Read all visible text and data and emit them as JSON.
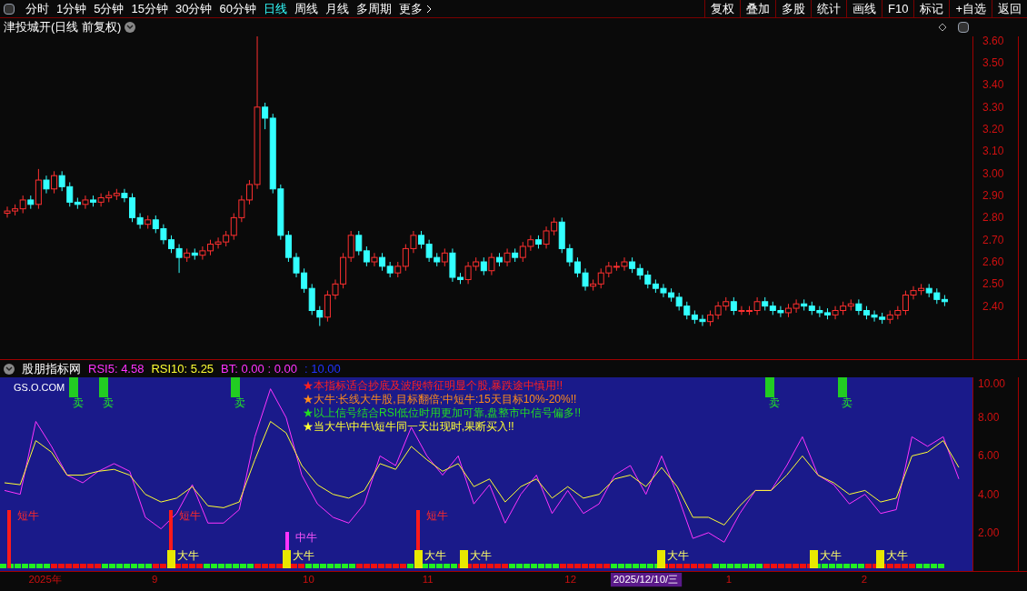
{
  "toolbar": {
    "periods": [
      {
        "label": "分时",
        "selected": false
      },
      {
        "label": "1分钟",
        "selected": false
      },
      {
        "label": "5分钟",
        "selected": false
      },
      {
        "label": "15分钟",
        "selected": false
      },
      {
        "label": "30分钟",
        "selected": false
      },
      {
        "label": "60分钟",
        "selected": false
      },
      {
        "label": "日线",
        "selected": true
      },
      {
        "label": "周线",
        "selected": false
      },
      {
        "label": "月线",
        "selected": false
      },
      {
        "label": "多周期",
        "selected": false
      }
    ],
    "more": "更多",
    "buttons": [
      "复权",
      "叠加",
      "多股",
      "统计",
      "画线",
      "F10",
      "标记",
      "+自选",
      "返回"
    ]
  },
  "main_chart": {
    "title": "津投城开(日线 前复权)",
    "chart_data": {
      "type": "candlestick",
      "ylim": [
        2.16,
        3.62
      ],
      "yticks": [
        {
          "value": 3.6,
          "label": "3.60"
        },
        {
          "value": 3.5,
          "label": "3.50"
        },
        {
          "value": 3.4,
          "label": "3.40"
        },
        {
          "value": 3.3,
          "label": "3.30"
        },
        {
          "value": 3.2,
          "label": "3.20"
        },
        {
          "value": 3.1,
          "label": "3.10"
        },
        {
          "value": 3.0,
          "label": "3.00"
        },
        {
          "value": 2.9,
          "label": "2.90"
        },
        {
          "value": 2.8,
          "label": "2.80"
        },
        {
          "value": 2.7,
          "label": "2.70"
        },
        {
          "value": 2.6,
          "label": "2.60"
        },
        {
          "value": 2.5,
          "label": "2.50"
        },
        {
          "value": 2.4,
          "label": "2.40"
        }
      ],
      "ohlc": [
        [
          2.82,
          2.85,
          2.8,
          2.83
        ],
        [
          2.83,
          2.86,
          2.81,
          2.84
        ],
        [
          2.84,
          2.9,
          2.82,
          2.88
        ],
        [
          2.88,
          2.9,
          2.84,
          2.86
        ],
        [
          2.86,
          3.02,
          2.84,
          2.97
        ],
        [
          2.97,
          2.99,
          2.91,
          2.93
        ],
        [
          2.93,
          3.01,
          2.91,
          2.99
        ],
        [
          2.99,
          3.01,
          2.92,
          2.94
        ],
        [
          2.94,
          2.96,
          2.85,
          2.87
        ],
        [
          2.87,
          2.89,
          2.84,
          2.86
        ],
        [
          2.86,
          2.9,
          2.84,
          2.88
        ],
        [
          2.88,
          2.9,
          2.85,
          2.87
        ],
        [
          2.87,
          2.91,
          2.85,
          2.89
        ],
        [
          2.89,
          2.92,
          2.87,
          2.9
        ],
        [
          2.9,
          2.93,
          2.88,
          2.91
        ],
        [
          2.91,
          2.93,
          2.87,
          2.89
        ],
        [
          2.89,
          2.91,
          2.78,
          2.8
        ],
        [
          2.8,
          2.82,
          2.75,
          2.77
        ],
        [
          2.77,
          2.81,
          2.75,
          2.79
        ],
        [
          2.79,
          2.81,
          2.73,
          2.75
        ],
        [
          2.75,
          2.77,
          2.68,
          2.7
        ],
        [
          2.7,
          2.72,
          2.64,
          2.66
        ],
        [
          2.66,
          2.68,
          2.55,
          2.62
        ],
        [
          2.62,
          2.66,
          2.6,
          2.64
        ],
        [
          2.64,
          2.66,
          2.61,
          2.63
        ],
        [
          2.63,
          2.67,
          2.61,
          2.65
        ],
        [
          2.65,
          2.7,
          2.63,
          2.68
        ],
        [
          2.68,
          2.71,
          2.66,
          2.69
        ],
        [
          2.69,
          2.74,
          2.67,
          2.72
        ],
        [
          2.72,
          2.82,
          2.7,
          2.8
        ],
        [
          2.8,
          2.9,
          2.78,
          2.88
        ],
        [
          2.88,
          2.97,
          2.86,
          2.95
        ],
        [
          2.95,
          3.62,
          2.93,
          3.3
        ],
        [
          3.3,
          3.32,
          3.2,
          3.25
        ],
        [
          3.25,
          3.27,
          2.91,
          2.93
        ],
        [
          2.93,
          2.95,
          2.7,
          2.72
        ],
        [
          2.72,
          2.74,
          2.6,
          2.62
        ],
        [
          2.62,
          2.64,
          2.53,
          2.55
        ],
        [
          2.55,
          2.57,
          2.46,
          2.48
        ],
        [
          2.48,
          2.5,
          2.36,
          2.38
        ],
        [
          2.38,
          2.4,
          2.31,
          2.35
        ],
        [
          2.35,
          2.47,
          2.33,
          2.45
        ],
        [
          2.45,
          2.52,
          2.43,
          2.5
        ],
        [
          2.5,
          2.64,
          2.48,
          2.62
        ],
        [
          2.62,
          2.74,
          2.6,
          2.72
        ],
        [
          2.72,
          2.74,
          2.63,
          2.65
        ],
        [
          2.65,
          2.67,
          2.58,
          2.6
        ],
        [
          2.6,
          2.64,
          2.58,
          2.62
        ],
        [
          2.62,
          2.64,
          2.56,
          2.58
        ],
        [
          2.58,
          2.6,
          2.53,
          2.55
        ],
        [
          2.55,
          2.6,
          2.53,
          2.58
        ],
        [
          2.58,
          2.68,
          2.56,
          2.66
        ],
        [
          2.66,
          2.74,
          2.64,
          2.72
        ],
        [
          2.72,
          2.74,
          2.66,
          2.68
        ],
        [
          2.68,
          2.7,
          2.6,
          2.62
        ],
        [
          2.62,
          2.64,
          2.58,
          2.6
        ],
        [
          2.6,
          2.66,
          2.58,
          2.64
        ],
        [
          2.64,
          2.66,
          2.51,
          2.53
        ],
        [
          2.53,
          2.55,
          2.5,
          2.52
        ],
        [
          2.52,
          2.6,
          2.5,
          2.58
        ],
        [
          2.58,
          2.62,
          2.56,
          2.6
        ],
        [
          2.6,
          2.62,
          2.54,
          2.56
        ],
        [
          2.56,
          2.64,
          2.54,
          2.62
        ],
        [
          2.62,
          2.64,
          2.58,
          2.6
        ],
        [
          2.6,
          2.66,
          2.58,
          2.64
        ],
        [
          2.64,
          2.66,
          2.6,
          2.62
        ],
        [
          2.62,
          2.69,
          2.6,
          2.67
        ],
        [
          2.67,
          2.72,
          2.65,
          2.7
        ],
        [
          2.7,
          2.72,
          2.66,
          2.68
        ],
        [
          2.68,
          2.76,
          2.66,
          2.74
        ],
        [
          2.74,
          2.8,
          2.72,
          2.78
        ],
        [
          2.78,
          2.8,
          2.64,
          2.66
        ],
        [
          2.66,
          2.68,
          2.58,
          2.6
        ],
        [
          2.6,
          2.62,
          2.53,
          2.55
        ],
        [
          2.55,
          2.57,
          2.47,
          2.49
        ],
        [
          2.49,
          2.52,
          2.47,
          2.5
        ],
        [
          2.5,
          2.57,
          2.48,
          2.55
        ],
        [
          2.55,
          2.6,
          2.53,
          2.58
        ],
        [
          2.58,
          2.6,
          2.56,
          2.58
        ],
        [
          2.58,
          2.62,
          2.56,
          2.6
        ],
        [
          2.6,
          2.62,
          2.55,
          2.57
        ],
        [
          2.57,
          2.59,
          2.52,
          2.54
        ],
        [
          2.54,
          2.56,
          2.48,
          2.5
        ],
        [
          2.5,
          2.52,
          2.46,
          2.48
        ],
        [
          2.48,
          2.5,
          2.44,
          2.46
        ],
        [
          2.46,
          2.48,
          2.42,
          2.44
        ],
        [
          2.44,
          2.46,
          2.38,
          2.4
        ],
        [
          2.4,
          2.42,
          2.34,
          2.36
        ],
        [
          2.36,
          2.38,
          2.32,
          2.34
        ],
        [
          2.34,
          2.36,
          2.31,
          2.33
        ],
        [
          2.33,
          2.38,
          2.31,
          2.36
        ],
        [
          2.36,
          2.42,
          2.34,
          2.4
        ],
        [
          2.4,
          2.44,
          2.38,
          2.42
        ],
        [
          2.42,
          2.44,
          2.36,
          2.38
        ],
        [
          2.38,
          2.4,
          2.36,
          2.38
        ],
        [
          2.38,
          2.4,
          2.36,
          2.38
        ],
        [
          2.38,
          2.44,
          2.36,
          2.42
        ],
        [
          2.42,
          2.44,
          2.38,
          2.4
        ],
        [
          2.4,
          2.42,
          2.36,
          2.38
        ],
        [
          2.38,
          2.4,
          2.35,
          2.37
        ],
        [
          2.37,
          2.41,
          2.35,
          2.39
        ],
        [
          2.39,
          2.43,
          2.37,
          2.41
        ],
        [
          2.41,
          2.43,
          2.38,
          2.4
        ],
        [
          2.4,
          2.42,
          2.36,
          2.38
        ],
        [
          2.38,
          2.4,
          2.35,
          2.37
        ],
        [
          2.37,
          2.39,
          2.34,
          2.36
        ],
        [
          2.36,
          2.4,
          2.34,
          2.38
        ],
        [
          2.38,
          2.42,
          2.36,
          2.4
        ],
        [
          2.4,
          2.43,
          2.38,
          2.41
        ],
        [
          2.41,
          2.43,
          2.36,
          2.38
        ],
        [
          2.38,
          2.4,
          2.34,
          2.36
        ],
        [
          2.36,
          2.38,
          2.33,
          2.35
        ],
        [
          2.35,
          2.37,
          2.32,
          2.34
        ],
        [
          2.34,
          2.38,
          2.32,
          2.36
        ],
        [
          2.36,
          2.4,
          2.34,
          2.38
        ],
        [
          2.38,
          2.47,
          2.36,
          2.45
        ],
        [
          2.45,
          2.49,
          2.43,
          2.47
        ],
        [
          2.47,
          2.5,
          2.45,
          2.48
        ],
        [
          2.48,
          2.5,
          2.44,
          2.46
        ],
        [
          2.46,
          2.48,
          2.41,
          2.43
        ],
        [
          2.43,
          2.45,
          2.4,
          2.42
        ]
      ]
    }
  },
  "indicator": {
    "name": "股朋指标网",
    "series_readings": [
      ": 4.58",
      ": 5.25"
    ],
    "readings": [
      {
        "text": "BT: 0.00 : 0.00",
        "color": "#ff33ff"
      },
      {
        "text": ": 10.00",
        "color": "#2233ff"
      }
    ],
    "site": "GS.O.COM",
    "notes": [
      {
        "text": "★本指标适合抄底及波段特征明显个股,暴跌途中慎用!!",
        "color": "#ff2020"
      },
      {
        "text": "★大牛:长线大牛股,目标翻倍;中短牛:15天目标10%-20%!!",
        "color": "#ff8c1a"
      },
      {
        "text": "★以上信号结合RSI低位时用更加可靠,盘整市中信号偏多!!",
        "color": "#22dd22"
      },
      {
        "text": "★当大牛\\中牛\\短牛同一天出现时,果断买入!!",
        "color": "#ffff33"
      }
    ],
    "sells": [
      "卖",
      "卖",
      "卖",
      "卖",
      "卖"
    ],
    "signals": [
      {
        "kind": "short",
        "label": "短牛"
      },
      {
        "kind": "short",
        "label": "短牛"
      },
      {
        "kind": "big",
        "label": "大牛"
      },
      {
        "kind": "mid",
        "label": "中牛"
      },
      {
        "kind": "big",
        "label": "大牛"
      },
      {
        "kind": "short",
        "label": "短牛"
      },
      {
        "kind": "big",
        "label": "大牛"
      },
      {
        "kind": "big",
        "label": "大牛"
      },
      {
        "kind": "big",
        "label": "大牛"
      },
      {
        "kind": "big",
        "label": "大牛"
      },
      {
        "kind": "big",
        "label": "大牛"
      }
    ],
    "chart_data": {
      "type": "line",
      "ylim": [
        0,
        10.1
      ],
      "yticks": [
        {
          "value": 10,
          "label": "10.00"
        },
        {
          "value": 8,
          "label": "8.00"
        },
        {
          "value": 6,
          "label": "6.00"
        },
        {
          "value": 4,
          "label": "4.00"
        },
        {
          "value": 2,
          "label": "2.00"
        }
      ],
      "series": [
        {
          "name": "RSI5",
          "color": "#ff33ff",
          "values": [
            4.2,
            4.0,
            7.8,
            6.5,
            5.0,
            4.6,
            5.2,
            5.6,
            5.2,
            2.8,
            2.2,
            3.0,
            4.5,
            2.5,
            2.5,
            3.2,
            7.0,
            9.5,
            8.0,
            5.0,
            3.5,
            2.8,
            2.5,
            3.5,
            6.0,
            5.5,
            7.5,
            6.0,
            5.0,
            6.0,
            3.5,
            4.5,
            2.5,
            4.0,
            5.0,
            3.0,
            4.2,
            3.0,
            3.5,
            5.0,
            5.5,
            4.0,
            6.0,
            4.0,
            1.7,
            2.0,
            1.5,
            3.0,
            4.2,
            4.2,
            5.5,
            7.0,
            5.0,
            4.5,
            3.5,
            4.0,
            3.0,
            3.2,
            7.0,
            6.5,
            7.0,
            4.8
          ]
        },
        {
          "name": "RSI10",
          "color": "#ffff33",
          "values": [
            4.6,
            4.5,
            6.8,
            6.2,
            5.0,
            5.0,
            5.2,
            5.3,
            5.0,
            4.0,
            3.6,
            3.8,
            4.4,
            3.4,
            3.3,
            3.6,
            5.8,
            7.8,
            7.2,
            5.5,
            4.5,
            4.0,
            3.8,
            4.2,
            5.6,
            5.3,
            6.5,
            5.8,
            5.2,
            5.6,
            4.4,
            4.8,
            3.6,
            4.4,
            4.8,
            3.8,
            4.4,
            3.8,
            4.0,
            4.8,
            5.0,
            4.4,
            5.4,
            4.4,
            2.8,
            2.8,
            2.4,
            3.4,
            4.2,
            4.2,
            5.0,
            6.0,
            5.0,
            4.6,
            4.0,
            4.2,
            3.6,
            3.8,
            6.0,
            6.2,
            6.8,
            5.4
          ]
        }
      ]
    }
  },
  "time_axis": [
    {
      "label": "2025年",
      "selected": false
    },
    {
      "label": "9",
      "selected": false
    },
    {
      "label": "10",
      "selected": false
    },
    {
      "label": "11",
      "selected": false
    },
    {
      "label": "12",
      "selected": false
    },
    {
      "label": "2025/12/10/三",
      "selected": true
    },
    {
      "label": "1",
      "selected": false
    },
    {
      "label": "2",
      "selected": false
    }
  ]
}
